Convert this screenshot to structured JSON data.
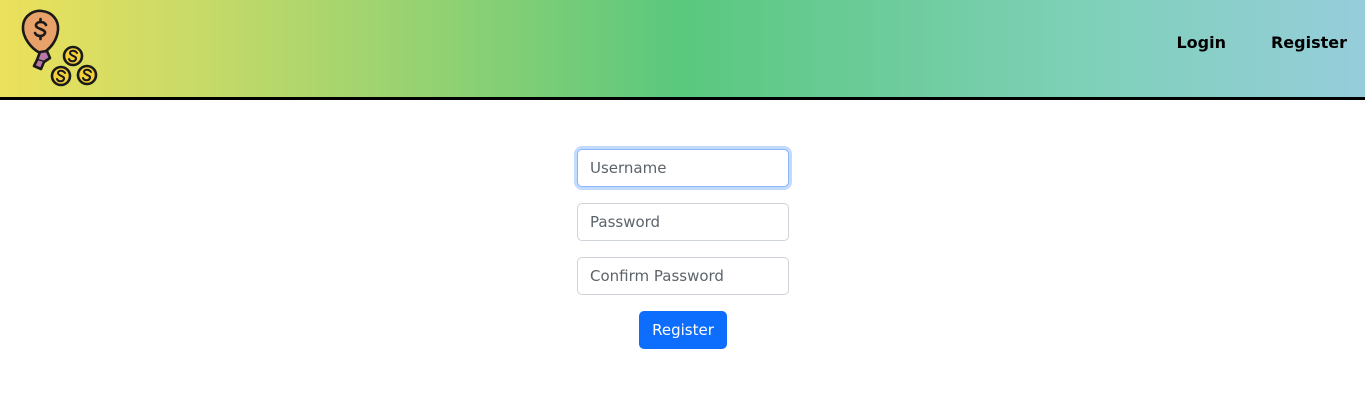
{
  "nav": {
    "logo_icon": "money-bag-coins-icon",
    "links": [
      {
        "label": "Login"
      },
      {
        "label": "Register"
      }
    ]
  },
  "form": {
    "username": {
      "value": "",
      "placeholder": "Username"
    },
    "password": {
      "value": "",
      "placeholder": "Password"
    },
    "confirm_password": {
      "value": "",
      "placeholder": "Confirm Password"
    },
    "submit_label": "Register"
  },
  "colors": {
    "header_gradient": [
      "#ece15c",
      "#5ac87e",
      "#96cddb"
    ],
    "primary_button": "#0d6efd",
    "focus_ring": "#86b7fe"
  }
}
